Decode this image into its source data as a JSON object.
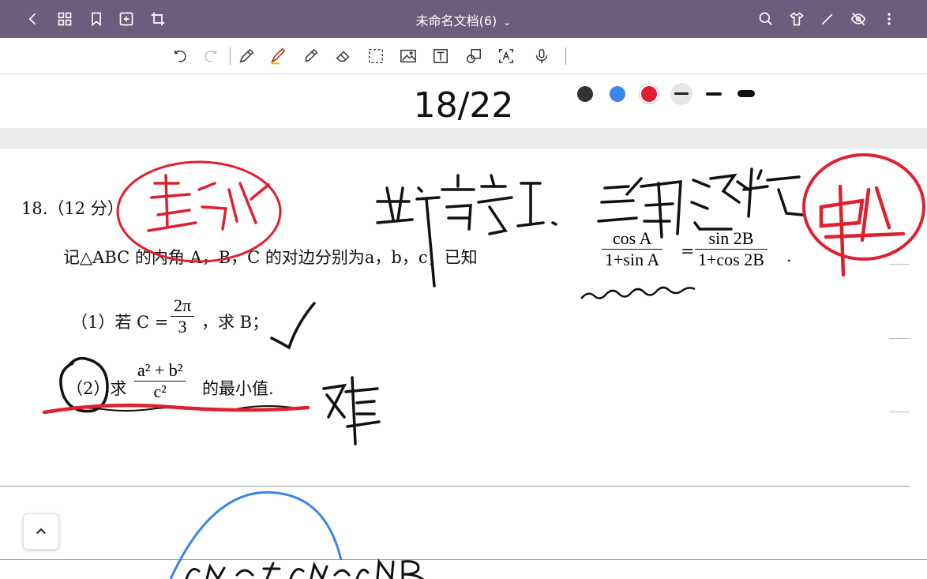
{
  "app": {
    "document_title": "未命名文档(6)"
  },
  "page": {
    "counter": "18/22"
  },
  "question": {
    "number": "18.（12 分）",
    "stem": "记△ABC 的内角 A，B，C 的对边分别为a，b，c，已知",
    "given_left_num": "cos A",
    "given_left_den": "1+sin A",
    "equals": "=",
    "given_right_num": "sin 2B",
    "given_right_den": "1+cos 2B",
    "stem_end": ".",
    "part1_prefix": "（1）若 C =",
    "part1_frac_num": "2π",
    "part1_frac_den": "3",
    "part1_suffix": "，求 B；",
    "part2_prefix": "（2）求",
    "part2_frac_num": "a² + b²",
    "part2_frac_den": "c²",
    "part2_suffix": "的最小值."
  },
  "colors": {
    "topbar": "#6e5c7c",
    "ink_black": "#111111",
    "ink_blue": "#3a86e8",
    "ink_red": "#e02030"
  },
  "toolbar_icons": [
    "undo-icon",
    "redo-icon",
    "pencil-icon",
    "pen-icon",
    "highlighter-icon",
    "eraser-icon",
    "lasso-icon",
    "image-icon",
    "text-icon",
    "shape-icon",
    "ocr-icon",
    "mic-icon"
  ]
}
